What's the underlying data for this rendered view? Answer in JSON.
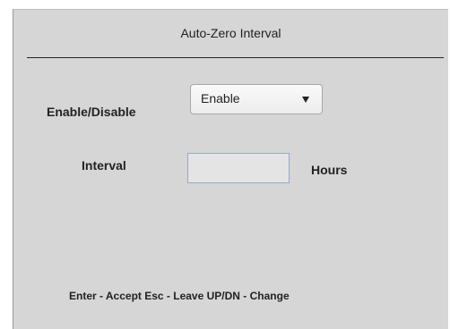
{
  "dialog": {
    "title": "Auto-Zero Interval"
  },
  "enable_field": {
    "label": "Enable/Disable",
    "selected": "Enable",
    "icon": "chevron-down-icon"
  },
  "interval_field": {
    "label": "Interval",
    "value": "",
    "unit": "Hours"
  },
  "footer": {
    "hint": "Enter - Accept Esc - Leave UP/DN - Change"
  }
}
